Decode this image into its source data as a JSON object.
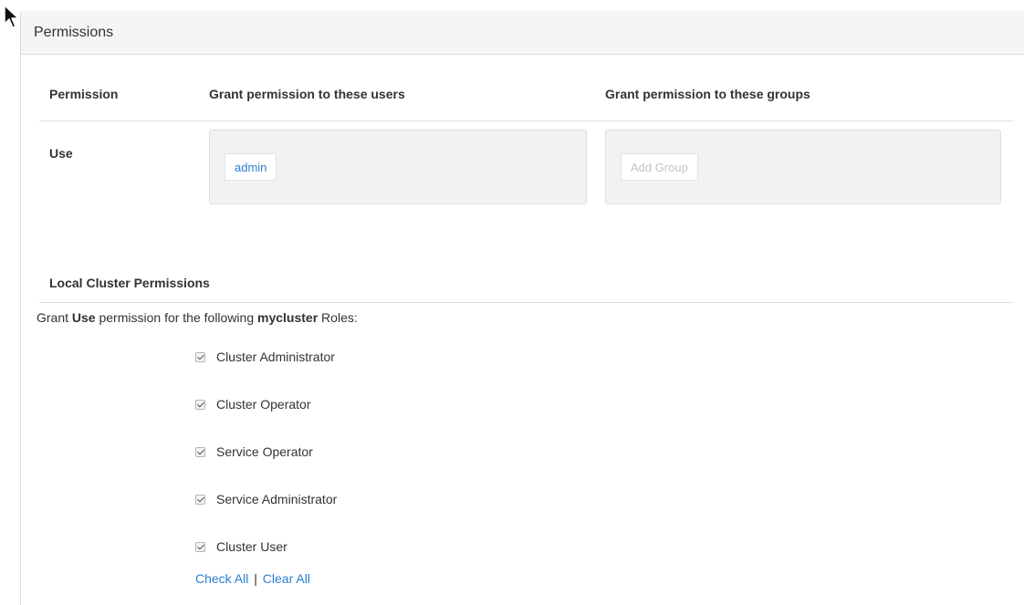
{
  "panel": {
    "title": "Permissions"
  },
  "table": {
    "headers": {
      "permission": "Permission",
      "users": "Grant permission to these users",
      "groups": "Grant permission to these groups"
    },
    "row": {
      "label": "Use",
      "users": [
        "admin"
      ],
      "group_placeholder": "Add Group"
    }
  },
  "local_cluster": {
    "title": "Local Cluster Permissions",
    "grant_prefix": "Grant ",
    "grant_permission": "Use",
    "grant_middle": " permission for the following ",
    "cluster_name": "mycluster",
    "grant_suffix": " Roles:",
    "roles": [
      {
        "label": "Cluster Administrator",
        "checked": true
      },
      {
        "label": "Cluster Operator",
        "checked": true
      },
      {
        "label": "Service Operator",
        "checked": true
      },
      {
        "label": "Service Administrator",
        "checked": true
      },
      {
        "label": "Cluster User",
        "checked": true
      }
    ],
    "check_all": "Check All",
    "separator": "|",
    "clear_all": "Clear All"
  }
}
